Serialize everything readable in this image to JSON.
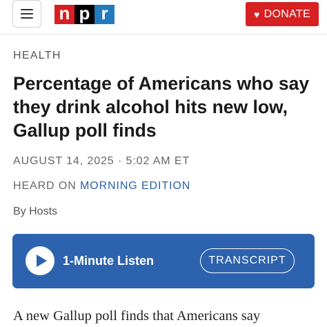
{
  "header": {
    "logo_letters": [
      "n",
      "p",
      "r"
    ],
    "logo_colors": [
      "#d62021",
      "#000000",
      "#237bbd"
    ],
    "menu_icon": "hamburger-menu-icon",
    "donate_icon": "heart-icon",
    "donate_label": "DONATE",
    "accent_color": "#d62021"
  },
  "article": {
    "section": "HEALTH",
    "headline": "Percentage of Americans who say they drink alcohol hits new low, Gallup poll finds",
    "date": "AUGUST 14, 2025 · 5:02 AM ET",
    "heard_on_prefix": "HEARD ON",
    "heard_on_show": "MORNING EDITION",
    "byline": "By Hosts",
    "body_first_line": "A new Gallup poll finds that Americans say"
  },
  "player": {
    "play_icon": "play-icon",
    "listen_label": "1-Minute Listen",
    "transcript_label": "TRANSCRIPT",
    "background_color": "#2d63ae"
  }
}
